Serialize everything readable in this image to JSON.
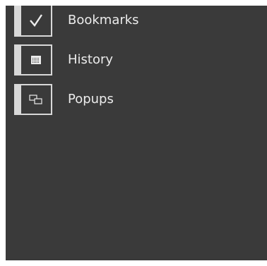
{
  "menu": {
    "items": [
      {
        "label": "Bookmarks",
        "icon": "checkmark-icon"
      },
      {
        "label": "History",
        "icon": "calendar-grid-icon"
      },
      {
        "label": "Popups",
        "icon": "popup-windows-icon"
      }
    ]
  },
  "colors": {
    "panel_background": "#3a3a3a",
    "tile_accent": "#d8d8d8",
    "label_text": "#ececec"
  }
}
